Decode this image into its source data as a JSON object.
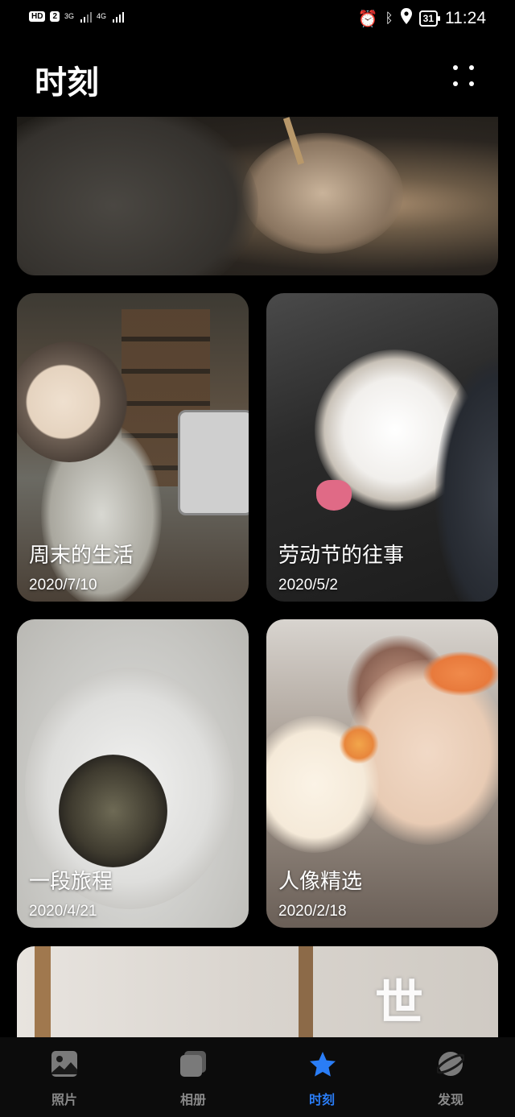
{
  "status_bar": {
    "hd_badge": "HD",
    "sim_slot": "2",
    "net1": "3G",
    "net2": "4G",
    "battery": "31",
    "time": "11:24"
  },
  "header": {
    "title": "时刻"
  },
  "moments": [
    {
      "title": "周末的生活",
      "date": "2020/7/10"
    },
    {
      "title": "劳动节的往事",
      "date": "2020/5/2"
    },
    {
      "title": "一段旅程",
      "date": "2020/4/21"
    },
    {
      "title": "人像精选",
      "date": "2020/2/18"
    }
  ],
  "banner_bottom_text": "世",
  "bottom_nav": [
    {
      "label": "照片",
      "icon": "photo-icon"
    },
    {
      "label": "相册",
      "icon": "album-icon"
    },
    {
      "label": "时刻",
      "icon": "star-icon",
      "active": true
    },
    {
      "label": "发现",
      "icon": "discover-icon"
    }
  ],
  "colors": {
    "background": "#000000",
    "accent": "#2A7DF6",
    "inactive": "#8A8A8A"
  }
}
